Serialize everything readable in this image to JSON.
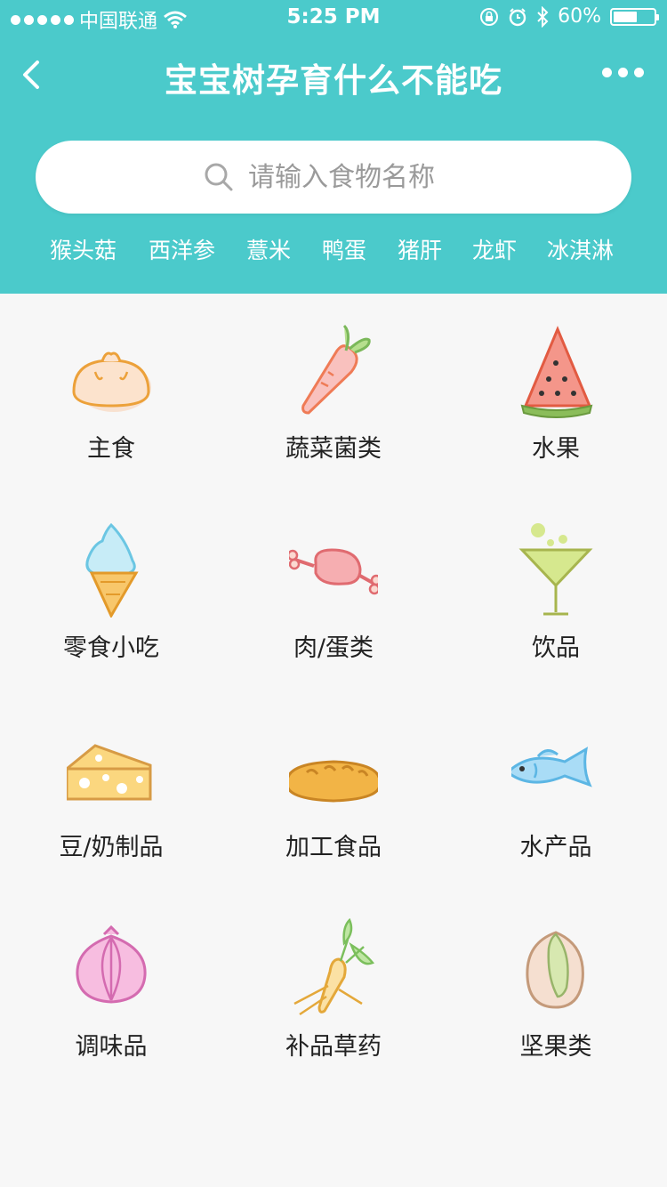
{
  "status": {
    "carrier": "中国联通",
    "time": "5:25 PM",
    "battery": "60%",
    "battery_level": 0.6
  },
  "nav": {
    "title": "宝宝树孕育什么不能吃"
  },
  "search": {
    "placeholder": "请输入食物名称"
  },
  "hot_tags": [
    "猴头菇",
    "西洋参",
    "薏米",
    "鸭蛋",
    "猪肝",
    "龙虾",
    "冰淇淋"
  ],
  "categories": [
    {
      "label": "主食",
      "icon": "bun-icon"
    },
    {
      "label": "蔬菜菌类",
      "icon": "carrot-icon"
    },
    {
      "label": "水果",
      "icon": "watermelon-icon"
    },
    {
      "label": "零食小吃",
      "icon": "ice-cream-icon"
    },
    {
      "label": "肉/蛋类",
      "icon": "meat-icon"
    },
    {
      "label": "饮品",
      "icon": "cocktail-icon"
    },
    {
      "label": "豆/奶制品",
      "icon": "cheese-icon"
    },
    {
      "label": "加工食品",
      "icon": "bread-icon"
    },
    {
      "label": "水产品",
      "icon": "fish-icon"
    },
    {
      "label": "调味品",
      "icon": "onion-icon"
    },
    {
      "label": "补品草药",
      "icon": "ginseng-icon"
    },
    {
      "label": "坚果类",
      "icon": "pistachio-icon"
    }
  ],
  "colors": {
    "header": "#4bcacb",
    "background": "#f7f7f7"
  }
}
